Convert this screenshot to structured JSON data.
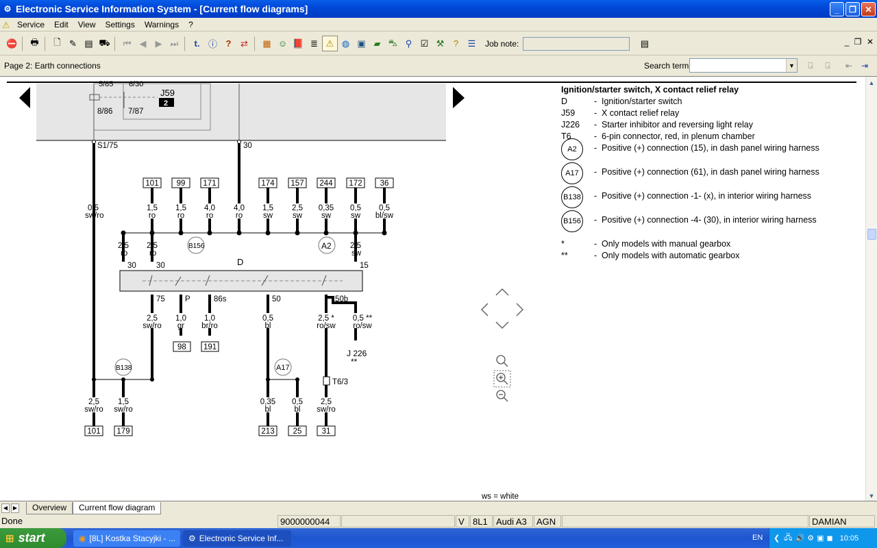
{
  "window": {
    "title": "Electronic Service Information System - [Current flow diagrams]"
  },
  "menu": {
    "items": [
      "Service",
      "Edit",
      "View",
      "Settings",
      "Warnings",
      "?"
    ]
  },
  "toolbar": {
    "job_note_label": "Job note:",
    "job_note_value": ""
  },
  "pagebar": {
    "page_label": "Page 2: Earth connections",
    "search_label": "Search term:",
    "search_value": ""
  },
  "legend": {
    "title": "Ignition/starter switch, X contact relief relay",
    "rows": [
      {
        "code": "D",
        "text": "Ignition/starter switch"
      },
      {
        "code": "J59",
        "text": "X contact relief relay"
      },
      {
        "code": "J226",
        "text": "Starter inhibitor and reversing light relay"
      },
      {
        "code": "T6",
        "text": "6-pin connector, red, in plenum chamber"
      }
    ],
    "circles": [
      {
        "code": "A2",
        "text": "Positive (+) connection (15), in dash panel wiring harness"
      },
      {
        "code": "A17",
        "text": "Positive (+) connection (61), in dash panel wiring harness"
      },
      {
        "code": "B138",
        "text": "Positive (+) connection -1- (x), in interior wiring harness"
      },
      {
        "code": "B156",
        "text": "Positive (+) connection -4- (30), in interior wiring harness"
      }
    ],
    "notes": [
      {
        "code": "*",
        "text": "Only models with manual gearbox"
      },
      {
        "code": "**",
        "text": "Only models with automatic gearbox"
      }
    ],
    "color_note": "ws = white"
  },
  "diagram": {
    "relay": {
      "name": "J59",
      "badge": "2",
      "pins": [
        "5/85",
        "6/30",
        "8/86",
        "7/87"
      ]
    },
    "top_terms": [
      "S1/75",
      "30"
    ],
    "top_boxes": [
      "101",
      "99",
      "171",
      "174",
      "157",
      "244",
      "172",
      "36"
    ],
    "top_wires": [
      [
        "1,5",
        "ro"
      ],
      [
        "1,5",
        "ro"
      ],
      [
        "4,0",
        "ro"
      ],
      [
        "4,0",
        "ro"
      ],
      [
        "1,5",
        "sw"
      ],
      [
        "2,5",
        "sw"
      ],
      [
        "0,35",
        "sw"
      ],
      [
        "0,5",
        "sw"
      ],
      [
        "0,5",
        "bl/sw"
      ]
    ],
    "left_wire": [
      "0,5",
      "sw/ro"
    ],
    "mid_wires": [
      [
        "2,5",
        "ro"
      ],
      [
        "2,5",
        "ro"
      ],
      [
        "2,5",
        "sw"
      ]
    ],
    "switch": {
      "name": "D",
      "in": [
        "30",
        "30",
        "15"
      ],
      "out": [
        "75",
        "P",
        "86s",
        "50",
        "50b"
      ]
    },
    "low_wires": [
      [
        "2,5",
        "sw/ro"
      ],
      [
        "1,0",
        "gr"
      ],
      [
        "1,0",
        "br/ro"
      ],
      [
        "0,5",
        "bl"
      ],
      [
        "2,5 *",
        "ro/sw"
      ],
      [
        "0,5 **",
        "ro/sw"
      ]
    ],
    "low_boxes": [
      "98",
      "191"
    ],
    "j226": {
      "name": "J 226",
      "mark": "**"
    },
    "connectors": {
      "b156": "B156",
      "a2": "A2",
      "b138": "B138",
      "a17": "A17",
      "t6": "T6/3"
    },
    "bottom_wires": [
      [
        "2,5",
        "sw/ro"
      ],
      [
        "1,5",
        "sw/ro"
      ],
      [
        "0,35",
        "bl"
      ],
      [
        "0,5",
        "bl"
      ],
      [
        "2,5",
        "sw/ro"
      ]
    ],
    "bottom_boxes": [
      "101",
      "179",
      "213",
      "25",
      "31"
    ]
  },
  "tabs": [
    "Overview",
    "Current flow diagram"
  ],
  "status": {
    "left": "Done",
    "id": "9000000044",
    "v": "V",
    "model_code": "8L1",
    "model": "Audi A3",
    "engine": "AGN",
    "user": "DAMIAN"
  },
  "taskbar": {
    "start": "start",
    "tasks": [
      "[8L] Kostka Stacyjki - ...",
      "Electronic Service Inf..."
    ],
    "lang": "EN",
    "time": "10:05"
  }
}
